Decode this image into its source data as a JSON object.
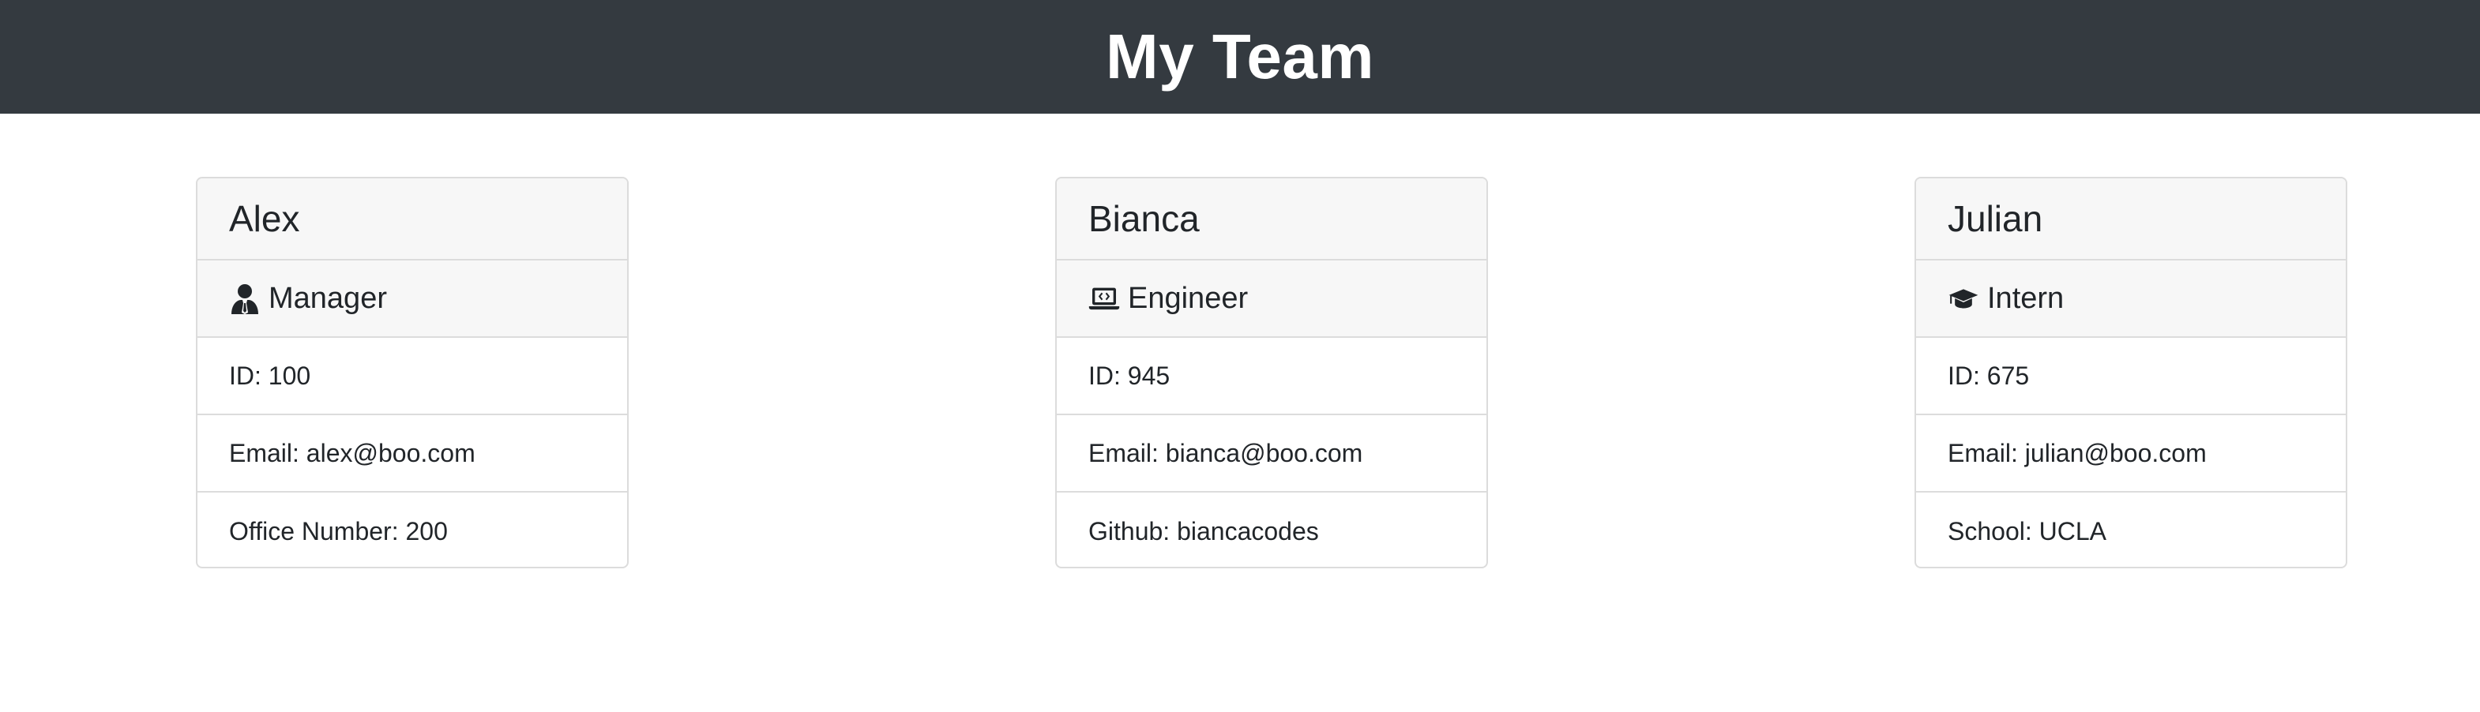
{
  "header": {
    "title": "My Team"
  },
  "team": [
    {
      "name": "Alex",
      "role": "Manager",
      "icon": "manager-icon",
      "rows": [
        "ID: 100",
        "Email: alex@boo.com",
        "Office Number: 200"
      ]
    },
    {
      "name": "Bianca",
      "role": "Engineer",
      "icon": "laptop-code-icon",
      "rows": [
        "ID: 945",
        "Email: bianca@boo.com",
        "Github: biancacodes"
      ]
    },
    {
      "name": "Julian",
      "role": "Intern",
      "icon": "graduation-cap-icon",
      "rows": [
        "ID: 675",
        "Email: julian@boo.com",
        "School: UCLA"
      ]
    }
  ],
  "colors": {
    "header_bg": "#343a40",
    "header_text": "#ffffff",
    "card_head_bg": "#f7f7f7",
    "border": "#dcdcdc"
  }
}
